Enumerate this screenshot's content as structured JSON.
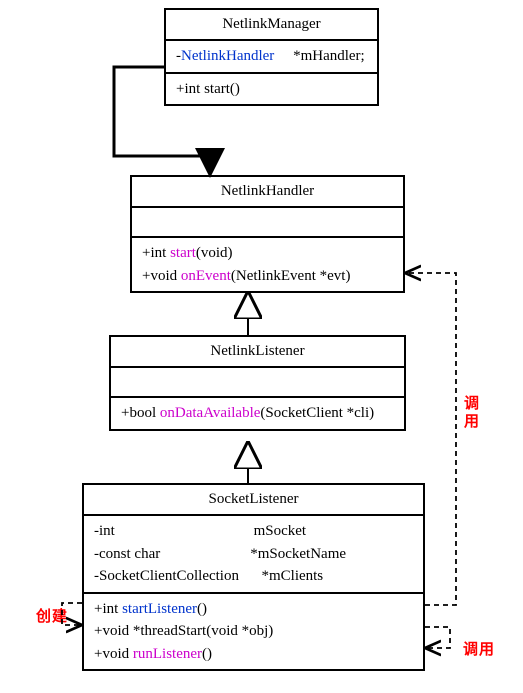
{
  "classes": {
    "netlinkManager": {
      "title": "NetlinkManager",
      "attrs": [
        {
          "prefix": "-",
          "type": "NetlinkHandler",
          "name": "*mHandler;"
        }
      ],
      "ops": [
        {
          "prefix": "+",
          "ret": "int ",
          "name": "start",
          "params": "()"
        }
      ]
    },
    "netlinkHandler": {
      "title": "NetlinkHandler",
      "attrs": [],
      "ops": [
        {
          "prefix": "+",
          "ret": "int ",
          "name": "start",
          "params": "(void)"
        },
        {
          "prefix": "+",
          "ret": "void ",
          "name": "onEvent",
          "params": "(NetlinkEvent *evt)"
        }
      ]
    },
    "netlinkListener": {
      "title": "NetlinkListener",
      "attrs": [],
      "ops": [
        {
          "prefix": "+",
          "ret": "bool ",
          "name": "onDataAvailable",
          "params": "(SocketClient *cli)"
        }
      ]
    },
    "socketListener": {
      "title": "SocketListener",
      "attrs_raw": [
        "-int                                     mSocket",
        "-const char                        *mSocketName",
        "-SocketClientCollection      *mClients"
      ],
      "ops": [
        {
          "prefix": "+",
          "ret": "int ",
          "name": "startListener",
          "params": "()"
        },
        {
          "prefix": "+",
          "ret": "void *",
          "name": "threadStart",
          "params": "(void *obj)"
        },
        {
          "prefix": "+",
          "ret": "void ",
          "name": "runListener",
          "params": "()"
        }
      ]
    }
  },
  "labels": {
    "call": "调用",
    "create": "创建"
  },
  "colors": {
    "highlight_type": "#0033cc",
    "highlight_method": "#cc00cc",
    "edge_label": "#ff0000"
  }
}
